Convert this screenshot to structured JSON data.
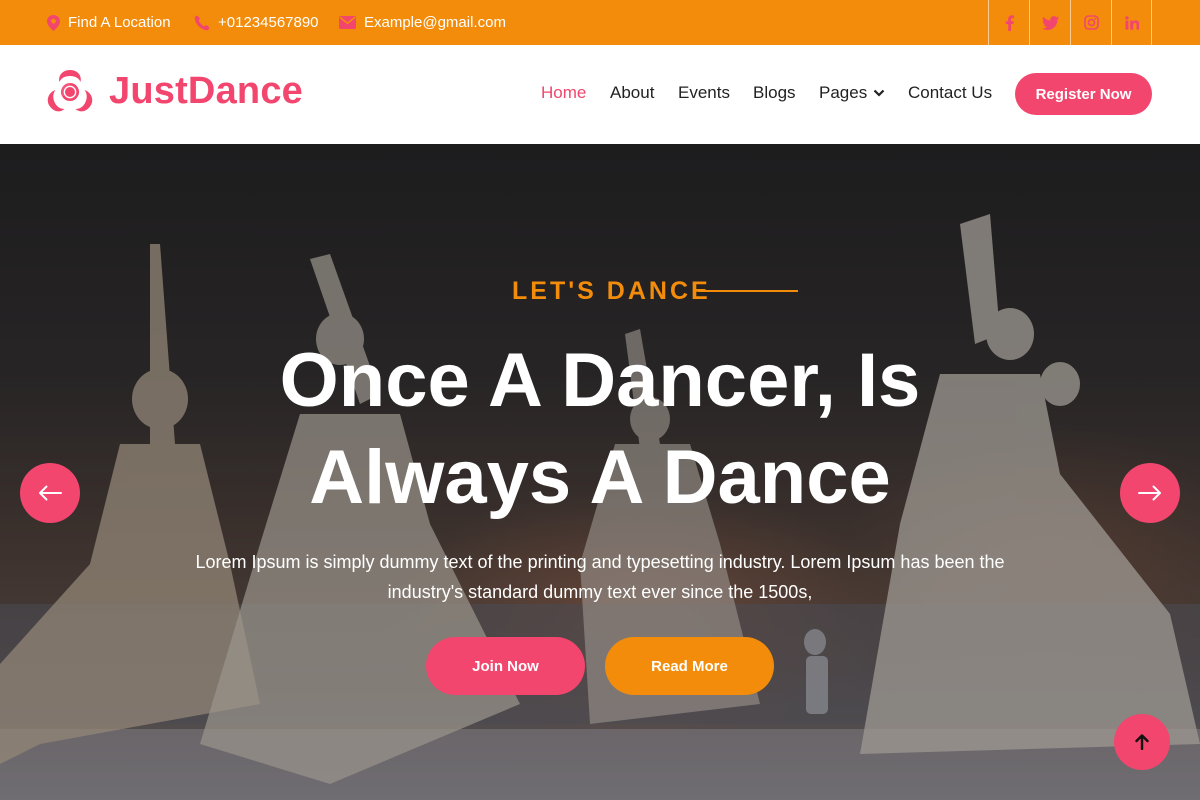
{
  "colors": {
    "primary": "#f2466e",
    "accent": "#f28c0a",
    "text": "#222222"
  },
  "topbar": {
    "location": "Find A Location",
    "phone": "+01234567890",
    "email": "Example@gmail.com",
    "location_icon": "map-pin-icon",
    "phone_icon": "phone-icon",
    "email_icon": "envelope-icon",
    "socials": [
      "facebook-icon",
      "twitter-icon",
      "instagram-icon",
      "linkedin-icon"
    ]
  },
  "header": {
    "brand": "JustDance",
    "logo_icon": "biohazard-icon",
    "nav": [
      "Home",
      "About",
      "Events",
      "Blogs",
      "Pages",
      "Contact Us"
    ],
    "active_nav": "Home",
    "register": "Register Now"
  },
  "hero": {
    "kicker": "LET'S DANCE",
    "headline_1": "Once A Dancer, Is",
    "headline_2": "Always A Dance",
    "desc_1": "Lorem Ipsum is simply dummy text of the printing and typesetting industry. Lorem Ipsum has been the",
    "desc_2": "industry's standard dummy text ever since the 1500s,",
    "join": "Join Now",
    "read": "Read More"
  }
}
